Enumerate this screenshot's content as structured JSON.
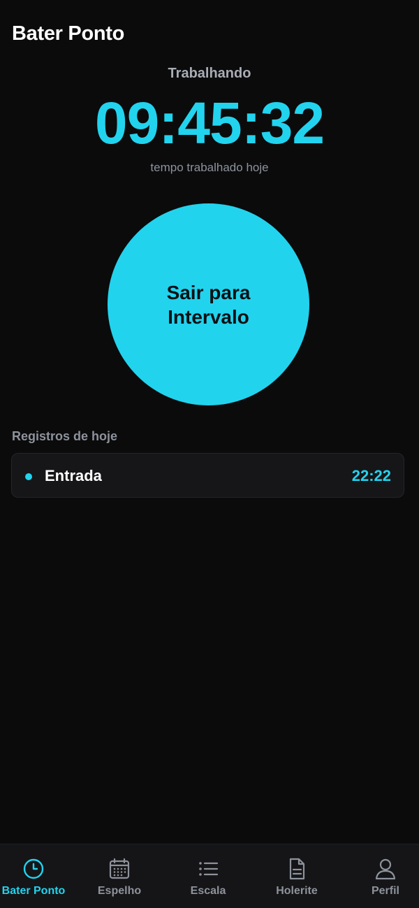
{
  "header": {
    "title": "Bater Ponto"
  },
  "clock": {
    "status": "Trabalhando",
    "elapsed": "09:45:32",
    "caption": "tempo trabalhado hoje"
  },
  "action": {
    "label": "Sair para Intervalo"
  },
  "records": {
    "section_title": "Registros de hoje",
    "items": [
      {
        "type": "Entrada",
        "time": "22:22"
      }
    ]
  },
  "tabbar": {
    "items": [
      {
        "label": "Bater Ponto",
        "icon": "clock-icon",
        "active": true
      },
      {
        "label": "Espelho",
        "icon": "calendar-icon",
        "active": false
      },
      {
        "label": "Escala",
        "icon": "list-icon",
        "active": false
      },
      {
        "label": "Holerite",
        "icon": "document-icon",
        "active": false
      },
      {
        "label": "Perfil",
        "icon": "user-icon",
        "active": false
      }
    ]
  },
  "colors": {
    "background": "#0b0b0c",
    "accent": "#22d3ee",
    "muted": "#8d929b",
    "card": "#161618"
  }
}
